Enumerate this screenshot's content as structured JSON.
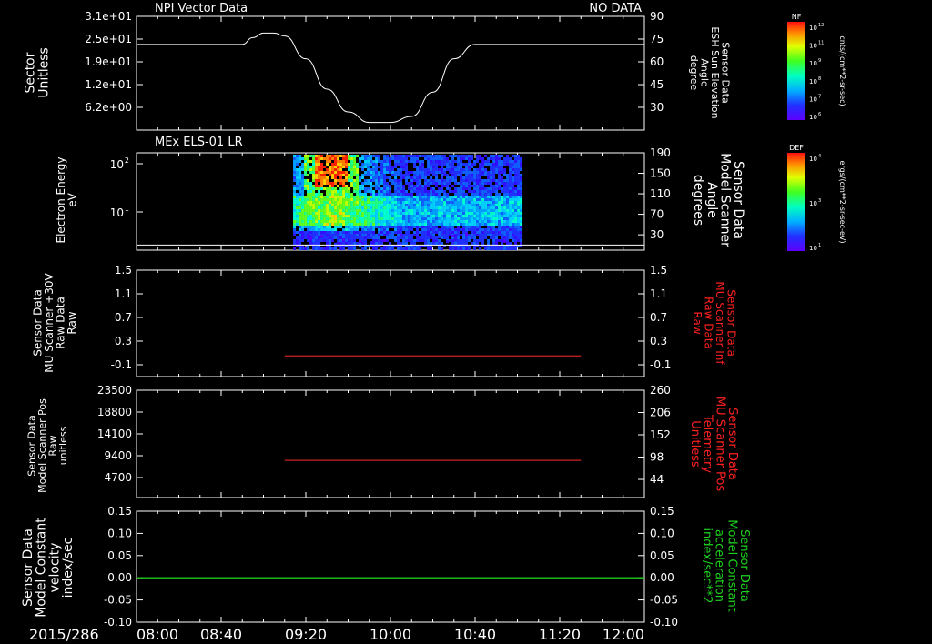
{
  "colors": {
    "background": "#000000",
    "foreground": "#ffffff",
    "red_trace": "#cc2020",
    "red_label": "#ff2020",
    "green_trace": "#1ec81e",
    "green_label": "#1ed21e"
  },
  "chart_data": [
    {
      "panel": 1,
      "type": "line",
      "top_left_title": "NPI Vector Data",
      "top_right_title": "NO DATA",
      "ylabel_left": [
        "Sector",
        "Unitless"
      ],
      "yticks_left": [
        "3.1e+01",
        "2.5e+01",
        "1.9e+01",
        "1.2e+01",
        "6.2e+00"
      ],
      "ylabel_right": [
        "Sensor Data",
        "ESH Sun Elevation",
        "Angle",
        "degree"
      ],
      "yticks_right": [
        "90",
        "75",
        "60",
        "45",
        "30"
      ],
      "ylim": [
        15,
        90
      ],
      "x": [
        "08:00",
        "08:40",
        "08:50",
        "08:55",
        "09:00",
        "09:05",
        "09:10",
        "09:20",
        "09:30",
        "09:40",
        "09:50",
        "10:00",
        "10:10",
        "10:20",
        "10:30",
        "10:40",
        "11:20",
        "12:00"
      ],
      "y": [
        71.5,
        71.5,
        71.5,
        76,
        79,
        79,
        77,
        62,
        42,
        27,
        20,
        20,
        24,
        40,
        62,
        71.5,
        71.5,
        71.5
      ]
    },
    {
      "panel": 2,
      "type": "heatmap",
      "title": "MEx ELS-01 LR",
      "ylabel_left": [
        "Electron Energy",
        "eV"
      ],
      "yticks_left": [
        "10",
        "2",
        "10",
        "1"
      ],
      "ylabel_right": [
        "Sensor Data",
        "Model Scanner",
        "Angle",
        "degrees"
      ],
      "yticks_right": [
        "190",
        "150",
        "110",
        "70",
        "30"
      ],
      "ylim_right": [
        0,
        190
      ],
      "data_span": [
        "09:14",
        "11:02"
      ],
      "line_y_right": 10,
      "colorbar": {
        "label": "DEF",
        "unit": "ergs/(cm**2-sr-sec-eV)",
        "ticks": [
          "10",
          "10",
          "10"
        ],
        "tick_exps": [
          "4",
          "3",
          "1"
        ]
      }
    },
    {
      "panel": 3,
      "type": "line",
      "ylabel_left": [
        "Sensor Data",
        "MU Scanner +30V",
        "Raw Data",
        "Raw"
      ],
      "yticks_left": [
        "1.5",
        "1.1",
        "0.7",
        "0.3",
        "-0.1"
      ],
      "ylabel_right": [
        "Sensor Data",
        "MU Scanner Inf",
        "Raw Data",
        "Raw"
      ],
      "yticks_right": [
        "1.5",
        "1.1",
        "0.7",
        "0.3",
        "-0.1"
      ],
      "ylim": [
        -0.3,
        1.5
      ],
      "x": [
        "09:10",
        "11:30"
      ],
      "y": [
        0.05,
        0.05
      ]
    },
    {
      "panel": 4,
      "type": "line",
      "ylabel_left": [
        "Sensor Data",
        "Model Scanner Pos",
        "Raw",
        "unitless"
      ],
      "yticks_left": [
        "23500",
        "18800",
        "14100",
        "9400",
        "4700"
      ],
      "ylabel_right": [
        "Sensor Data",
        "MU Scanner Pos",
        "Telemetry",
        "Unitless"
      ],
      "yticks_right": [
        "260",
        "206",
        "152",
        "98",
        "44"
      ],
      "ylim_right": [
        0,
        260
      ],
      "x": [
        "09:10",
        "11:30"
      ],
      "y": [
        90,
        90
      ]
    },
    {
      "panel": 5,
      "type": "line",
      "ylabel_left": [
        "Sensor Data",
        "Model Constant",
        "velocity",
        "index/sec"
      ],
      "yticks_left": [
        "0.15",
        "0.10",
        "0.05",
        "0.00",
        "-0.05",
        "-0.10"
      ],
      "ylabel_right": [
        "Sensor Data",
        "Model Constant",
        "acceleration",
        "index/sec**2"
      ],
      "yticks_right": [
        "0.15",
        "0.10",
        "0.05",
        "0.00",
        "-0.05",
        "-0.10"
      ],
      "ylim": [
        -0.1,
        0.15
      ],
      "x": [
        "08:00",
        "12:00"
      ],
      "y": [
        0.0,
        0.0
      ]
    }
  ],
  "time_axis": {
    "date_label": "2015/286",
    "ticks": [
      "08:00",
      "08:40",
      "09:20",
      "10:00",
      "10:40",
      "11:20",
      "12:00"
    ]
  },
  "colorbars": [
    {
      "label": "NF",
      "unit": "cnts/(cm**2-sr-sec)",
      "ticks": [
        "10",
        "10",
        "10",
        "10",
        "10",
        "10"
      ],
      "tick_exps": [
        "12",
        "11",
        "9",
        "8",
        "7",
        "6"
      ]
    },
    {
      "label": "DEF",
      "unit": "ergs/(cm**2-sr-sec-eV)",
      "ticks": [
        "10",
        "10",
        "10"
      ],
      "tick_exps": [
        "4",
        "3",
        "1"
      ]
    }
  ]
}
